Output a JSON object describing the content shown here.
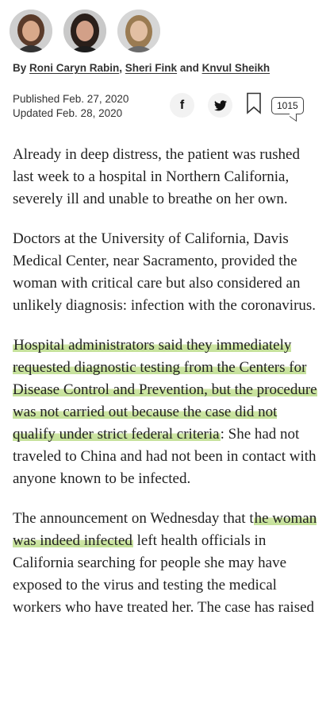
{
  "authors": [
    {
      "name": "Roni Caryn Rabin",
      "hair": "#5a3b2a",
      "skin": "#d9a98a",
      "bg": "#cfcfcf"
    },
    {
      "name": "Sheri Fink",
      "hair": "#2a1f1a",
      "skin": "#d2a088",
      "bg": "#c9c9c9"
    },
    {
      "name": "Knvul Sheikh",
      "hair": "#9a7b52",
      "skin": "#e2bfa3",
      "bg": "#d6d6d6"
    }
  ],
  "byline": {
    "prefix": "By ",
    "sep1": ", ",
    "sep2": " and "
  },
  "dates": {
    "published": "Published Feb. 27, 2020",
    "updated": "Updated Feb. 28, 2020"
  },
  "share": {
    "facebook_glyph": "f",
    "comment_count": "1015"
  },
  "colors": {
    "highlight": "#c5e19a"
  },
  "article": {
    "p1": "Already in deep distress, the patient was rushed last week to a hospital in Northern California, severely ill and unable to breathe on her own.",
    "p2": "Doctors at the University of California, Davis Medical Center, near Sacramento, provided the woman with critical care but also considered an unlikely diagnosis: infection with the coronavirus.",
    "p3_highlight": "Hospital administrators said they immediately requested diagnostic testing from the Centers for Disease Control and Prevention, but the procedure was not carried out because the case did not qualify under strict federal criteria",
    "p3_rest": ": She had not traveled to China and had not been in contact with anyone known to be infected.",
    "p4_a": "The announcement on Wednesday that t",
    "p4_highlight": "he woman was indeed infected",
    "p4_b": " left health officials in California searching for people she may have exposed to the virus and testing the medical workers who have treated her. The case has raised"
  }
}
